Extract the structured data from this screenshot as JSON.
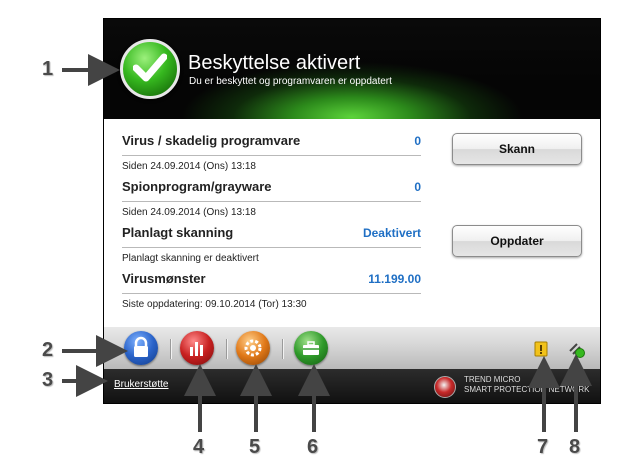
{
  "header": {
    "title": "Beskyttelse aktivert",
    "subtitle": "Du er beskyttet og programvaren er oppdatert"
  },
  "status_rows": [
    {
      "name": "Virus / skadelig programvare",
      "value": "0",
      "detail": "Siden 24.09.2014 (Ons) 13:18"
    },
    {
      "name": "Spionprogram/grayware",
      "value": "0",
      "detail": "Siden 24.09.2014 (Ons) 13:18"
    },
    {
      "name": "Planlagt skanning",
      "value": "Deaktivert",
      "detail": "Planlagt skanning er deaktivert"
    },
    {
      "name": "Virusmønster",
      "value": "11.199.00",
      "detail": "Siste oppdatering: 09.10.2014 (Tor) 13:30"
    }
  ],
  "buttons": {
    "scan": "Skann",
    "update": "Oppdater"
  },
  "toolbar": {
    "icons": [
      "lock-icon",
      "chart-bars-icon",
      "gear-icon",
      "toolbox-icon"
    ],
    "right_icons": [
      "notification-icon",
      "network-status-icon"
    ]
  },
  "footer": {
    "support_link": "Brukerstøtte",
    "brand_line1": "TREND MICRO",
    "brand_line2": "SMART PROTECTION NETWORK"
  },
  "callouts": [
    "1",
    "2",
    "3",
    "4",
    "5",
    "6",
    "7",
    "8"
  ],
  "colors": {
    "accent_value": "#1f6fc4",
    "header_glow": "#5cd33a"
  }
}
